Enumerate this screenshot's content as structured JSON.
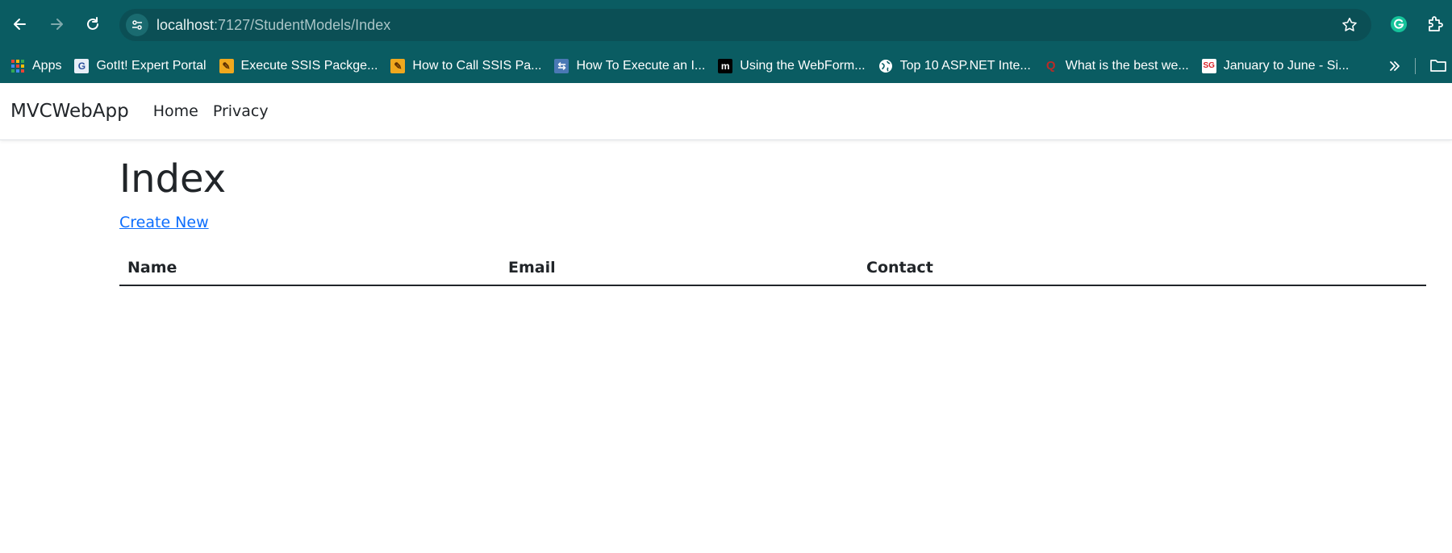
{
  "browser": {
    "url_host": "localhost",
    "url_rest": ":7127/StudentModels/Index",
    "bookmarks": [
      {
        "label": "Apps",
        "icon": "apps-grid-icon"
      },
      {
        "label": "GotIt! Expert Portal",
        "icon": "gotit-icon"
      },
      {
        "label": "Execute SSIS Packge...",
        "icon": "ssis-icon"
      },
      {
        "label": "How to Call SSIS Pa...",
        "icon": "ssis-icon"
      },
      {
        "label": "How To Execute an I...",
        "icon": "link-icon"
      },
      {
        "label": "Using the WebForm...",
        "icon": "m-icon"
      },
      {
        "label": "Top 10 ASP.NET Inte...",
        "icon": "globe-icon"
      },
      {
        "label": "What is the best we...",
        "icon": "quora-icon"
      },
      {
        "label": "January to June - Si...",
        "icon": "calendar-icon"
      }
    ]
  },
  "site": {
    "brand": "MVCWebApp",
    "nav": {
      "home": "Home",
      "privacy": "Privacy"
    }
  },
  "main": {
    "title": "Index",
    "create_link": "Create New",
    "table": {
      "headers": [
        "Name",
        "Email",
        "Contact"
      ],
      "rows": []
    }
  }
}
